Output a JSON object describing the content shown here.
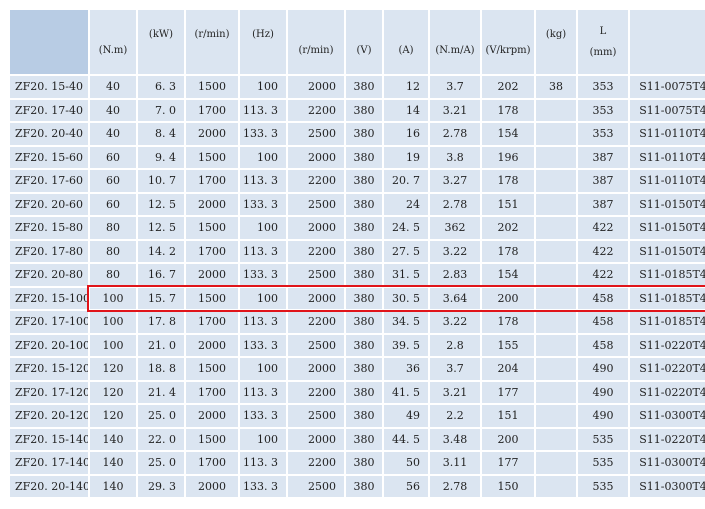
{
  "header": [
    {
      "label": "",
      "pos": "mid"
    },
    {
      "label": "(N.m)",
      "pos": "bot"
    },
    {
      "label": "(kW)",
      "pos": "top"
    },
    {
      "label": "(r/min)",
      "pos": "top"
    },
    {
      "label": "(Hz)",
      "pos": "top"
    },
    {
      "label": "(r/min)",
      "pos": "bot"
    },
    {
      "label": "(V)",
      "pos": "bot"
    },
    {
      "label": "(A)",
      "pos": "bot"
    },
    {
      "label": "(N.m/A)",
      "pos": "bot"
    },
    {
      "label": "(V/krpm)",
      "pos": "bot"
    },
    {
      "label": "(kg)",
      "pos": "top"
    },
    {
      "label": "L",
      "label2": "(mm)",
      "pos": "stack"
    },
    {
      "label": "",
      "pos": "mid"
    }
  ],
  "rows": [
    [
      "ZF20. 15-40",
      "40",
      "6. 3",
      "1500",
      "100",
      "2000",
      "380",
      "12",
      "3.7",
      "202",
      "38",
      "353",
      "S11-0075T4"
    ],
    [
      "ZF20. 17-40",
      "40",
      "7. 0",
      "1700",
      "113. 3",
      "2200",
      "380",
      "14",
      "3.21",
      "178",
      "",
      "353",
      "S11-0075T4"
    ],
    [
      "ZF20. 20-40",
      "40",
      "8. 4",
      "2000",
      "133. 3",
      "2500",
      "380",
      "16",
      "2.78",
      "154",
      "",
      "353",
      "S11-0110T4"
    ],
    [
      "ZF20. 15-60",
      "60",
      "9. 4",
      "1500",
      "100",
      "2000",
      "380",
      "19",
      "3.8",
      "196",
      "",
      "387",
      "S11-0110T4"
    ],
    [
      "ZF20. 17-60",
      "60",
      "10. 7",
      "1700",
      "113. 3",
      "2200",
      "380",
      "20. 7",
      "3.27",
      "178",
      "",
      "387",
      "S11-0110T4"
    ],
    [
      "ZF20. 20-60",
      "60",
      "12. 5",
      "2000",
      "133. 3",
      "2500",
      "380",
      "24",
      "2.78",
      "151",
      "",
      "387",
      "S11-0150T4"
    ],
    [
      "ZF20. 15-80",
      "80",
      "12. 5",
      "1500",
      "100",
      "2000",
      "380",
      "24. 5",
      "362",
      "202",
      "",
      "422",
      "S11-0150T4"
    ],
    [
      "ZF20. 17-80",
      "80",
      "14. 2",
      "1700",
      "113. 3",
      "2200",
      "380",
      "27. 5",
      "3.22",
      "178",
      "",
      "422",
      "S11-0150T4"
    ],
    [
      "ZF20. 20-80",
      "80",
      "16. 7",
      "2000",
      "133. 3",
      "2500",
      "380",
      "31. 5",
      "2.83",
      "154",
      "",
      "422",
      "S11-0185T4"
    ],
    [
      "ZF20. 15-100",
      "100",
      "15. 7",
      "1500",
      "100",
      "2000",
      "380",
      "30. 5",
      "3.64",
      "200",
      "",
      "458",
      "S11-0185T4"
    ],
    [
      "ZF20. 17-100",
      "100",
      "17. 8",
      "1700",
      "113. 3",
      "2200",
      "380",
      "34. 5",
      "3.22",
      "178",
      "",
      "458",
      "S11-0185T4"
    ],
    [
      "ZF20. 20-100",
      "100",
      "21. 0",
      "2000",
      "133. 3",
      "2500",
      "380",
      "39. 5",
      "2.8",
      "155",
      "",
      "458",
      "S11-0220T4"
    ],
    [
      "ZF20. 15-120",
      "120",
      "18. 8",
      "1500",
      "100",
      "2000",
      "380",
      "36",
      "3.7",
      "204",
      "",
      "490",
      "S11-0220T4"
    ],
    [
      "ZF20. 17-120",
      "120",
      "21. 4",
      "1700",
      "113. 3",
      "2200",
      "380",
      "41. 5",
      "3.21",
      "177",
      "",
      "490",
      "S11-0220T4"
    ],
    [
      "ZF20. 20-120",
      "120",
      "25. 0",
      "2000",
      "133. 3",
      "2500",
      "380",
      "49",
      "2.2",
      "151",
      "",
      "490",
      "S11-0300T4"
    ],
    [
      "ZF20. 15-140",
      "140",
      "22. 0",
      "1500",
      "100",
      "2000",
      "380",
      "44. 5",
      "3.48",
      "200",
      "",
      "535",
      "S11-0220T4"
    ],
    [
      "ZF20. 17-140",
      "140",
      "25. 0",
      "1700",
      "113. 3",
      "2200",
      "380",
      "50",
      "3.11",
      "177",
      "",
      "535",
      "S11-0300T4"
    ],
    [
      "ZF20. 20-140",
      "140",
      "29. 3",
      "2000",
      "133. 3",
      "2500",
      "380",
      "56",
      "2.78",
      "150",
      "",
      "535",
      "S11-0300T4"
    ]
  ],
  "highlighted_row": 9,
  "highlight_color": "#e0141a"
}
